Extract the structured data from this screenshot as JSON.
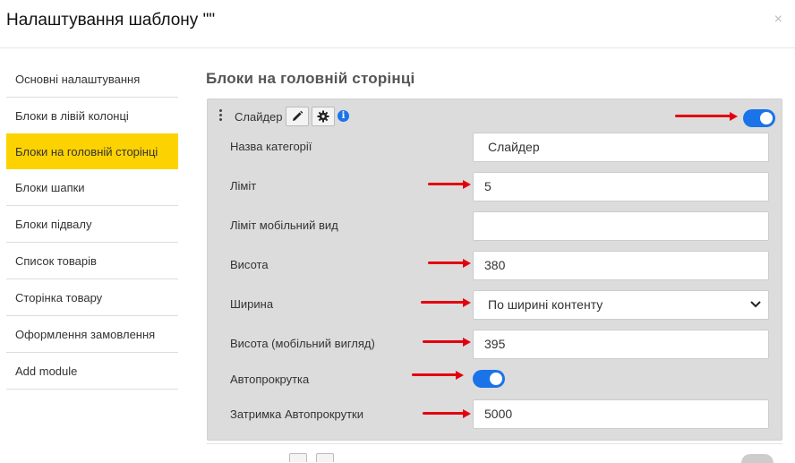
{
  "modal": {
    "title": "Налаштування шаблону \"\"",
    "close_label": "×"
  },
  "sidebar": {
    "items": [
      {
        "label": "Основні налаштування"
      },
      {
        "label": "Блоки в лівій колонці"
      },
      {
        "label": "Блоки на головній сторінці",
        "active": true
      },
      {
        "label": "Блоки шапки"
      },
      {
        "label": "Блоки підвалу"
      },
      {
        "label": "Список товарів"
      },
      {
        "label": "Сторінка товару"
      },
      {
        "label": "Оформлення замовлення"
      },
      {
        "label": "Add module"
      }
    ]
  },
  "main": {
    "section_title": "Блоки на головній сторінці",
    "block": {
      "name": "Слайдер",
      "enabled": true,
      "icons": [
        "drag-handle-icon",
        "pencil-icon",
        "gear-icon",
        "info-icon"
      ],
      "info_glyph": "i",
      "fields": {
        "category_name": {
          "label": "Назва категорії",
          "value": "Слайдер"
        },
        "limit": {
          "label": "Ліміт",
          "value": "5"
        },
        "limit_mobile": {
          "label": "Ліміт мобільний вид",
          "value": ""
        },
        "height": {
          "label": "Висота",
          "value": "380"
        },
        "width": {
          "label": "Ширина",
          "value": "По ширині контенту"
        },
        "height_mobile": {
          "label": "Висота (мобільний вигляд)",
          "value": "395"
        },
        "autoscroll": {
          "label": "Автопрокрутка",
          "enabled": true
        },
        "autoscroll_delay": {
          "label": "Затримка Автопрокрутки",
          "value": "5000"
        }
      }
    }
  },
  "colors": {
    "active_item": "#fcd201",
    "toggle_on": "#1a73e8",
    "annotation_arrow": "#e3000f",
    "panel_bg": "#dcdcdc"
  }
}
